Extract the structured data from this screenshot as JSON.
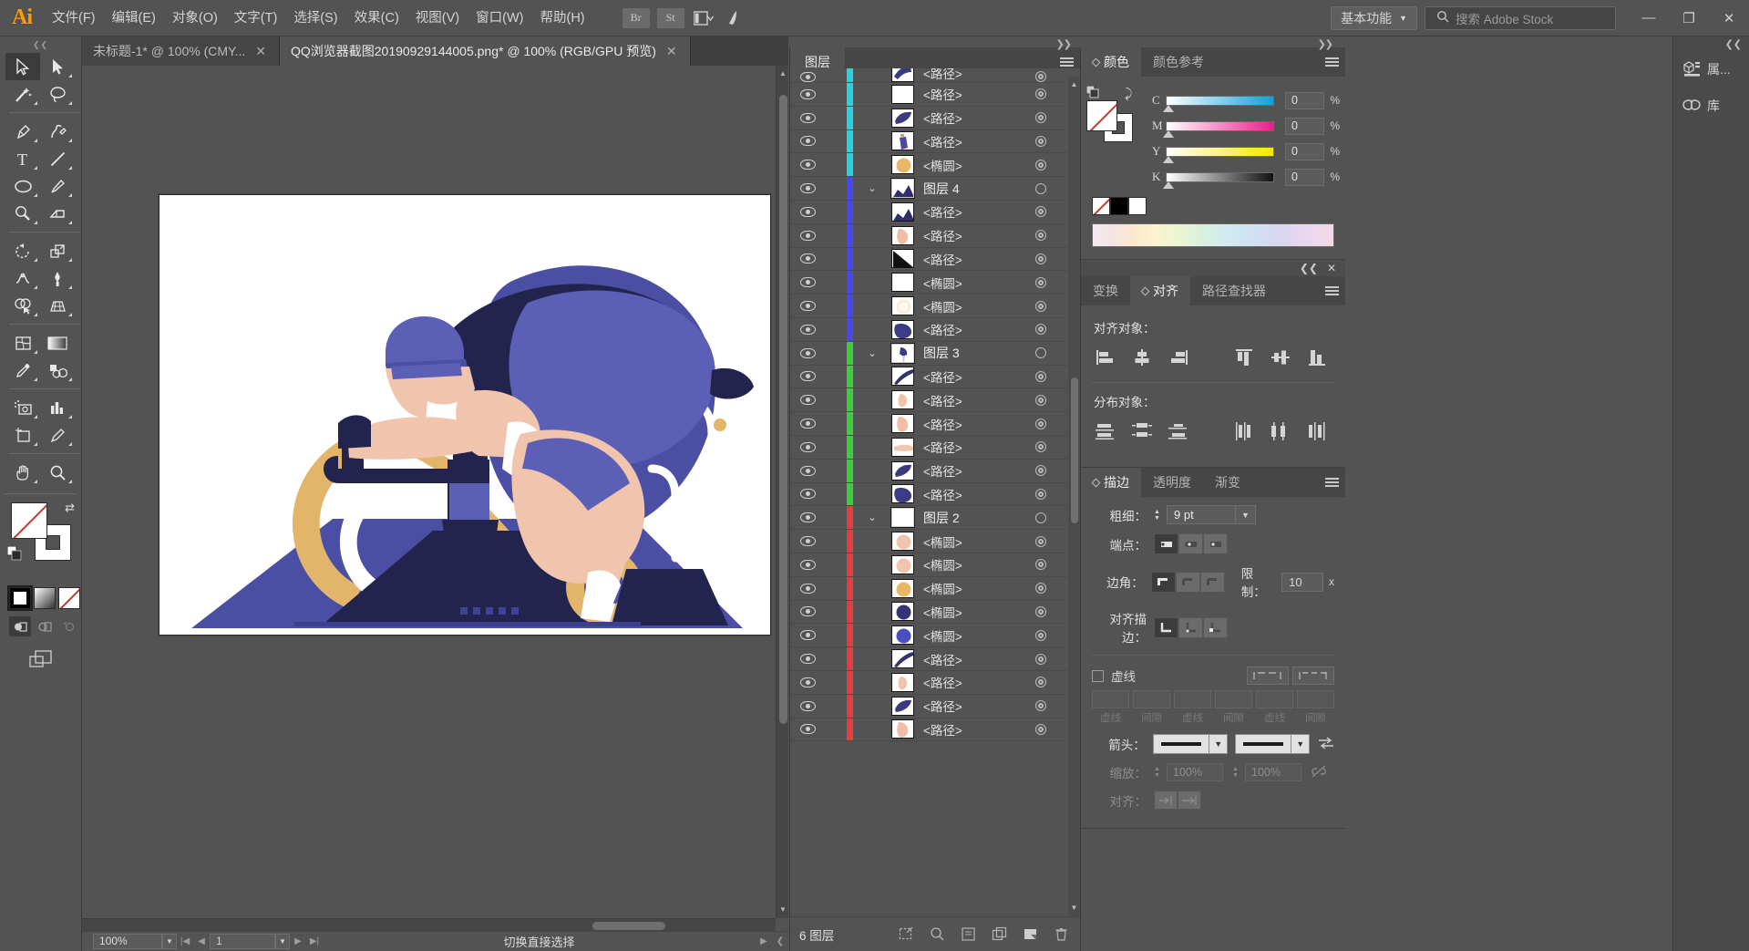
{
  "app": {
    "name": "Adobe Illustrator",
    "logo": "Ai"
  },
  "menubar": {
    "items": [
      {
        "label": "文件(F)",
        "name": "menu-file"
      },
      {
        "label": "编辑(E)",
        "name": "menu-edit"
      },
      {
        "label": "对象(O)",
        "name": "menu-object"
      },
      {
        "label": "文字(T)",
        "name": "menu-type"
      },
      {
        "label": "选择(S)",
        "name": "menu-select"
      },
      {
        "label": "效果(C)",
        "name": "menu-effect"
      },
      {
        "label": "视图(V)",
        "name": "menu-view"
      },
      {
        "label": "窗口(W)",
        "name": "menu-window"
      },
      {
        "label": "帮助(H)",
        "name": "menu-help"
      }
    ],
    "bridge_label": "Br",
    "stock_label": "St",
    "workspace": "基本功能",
    "search_placeholder": "搜索 Adobe Stock",
    "window_minimize": "—",
    "window_restore": "❐",
    "window_close": "✕"
  },
  "tabs": [
    {
      "title": "未标题-1* @ 100% (CMY...",
      "active": false,
      "close": "✕"
    },
    {
      "title": "QQ浏览器截图20190929144005.png* @ 100% (RGB/GPU 预览)",
      "active": true,
      "close": "✕"
    }
  ],
  "toolbar": {
    "tools": [
      {
        "name": "selection-tool",
        "selected": true
      },
      {
        "name": "direct-selection-tool",
        "selected": false
      },
      {
        "name": "magic-wand-tool",
        "selected": false
      },
      {
        "name": "lasso-tool",
        "selected": false
      },
      {
        "name": "pen-tool",
        "selected": false
      },
      {
        "name": "curvature-tool",
        "selected": false
      },
      {
        "name": "type-tool",
        "selected": false
      },
      {
        "name": "line-segment-tool",
        "selected": false
      },
      {
        "name": "ellipse-tool",
        "selected": false
      },
      {
        "name": "paintbrush-tool",
        "selected": false
      },
      {
        "name": "shaper-tool",
        "selected": false
      },
      {
        "name": "eraser-tool",
        "selected": false
      },
      {
        "name": "rotate-tool",
        "selected": false
      },
      {
        "name": "scale-tool",
        "selected": false
      },
      {
        "name": "width-tool",
        "selected": false
      },
      {
        "name": "free-transform-tool",
        "selected": false
      },
      {
        "name": "shape-builder-tool",
        "selected": false
      },
      {
        "name": "perspective-grid-tool",
        "selected": false
      },
      {
        "name": "mesh-tool",
        "selected": false
      },
      {
        "name": "gradient-tool",
        "selected": false
      },
      {
        "name": "eyedropper-tool",
        "selected": false
      },
      {
        "name": "blend-tool",
        "selected": false
      },
      {
        "name": "symbol-sprayer-tool",
        "selected": false
      },
      {
        "name": "column-graph-tool",
        "selected": false
      },
      {
        "name": "artboard-tool",
        "selected": false
      },
      {
        "name": "slice-tool",
        "selected": false
      },
      {
        "name": "hand-tool",
        "selected": false
      },
      {
        "name": "zoom-tool",
        "selected": false
      }
    ],
    "fill_state": "none",
    "stroke_state": "white"
  },
  "document": {
    "artboard_bg": "#ffffff",
    "zoom": "100%",
    "page": "1",
    "status_mode": "切换直接选择"
  },
  "artwork": {
    "title": "cyclist-illustration",
    "colors": {
      "dark_navy": "#23244d",
      "indigo": "#3f3f8f",
      "periwinkle": "#5b5fb5",
      "skin": "#f0c4ad",
      "skin_dark": "#e0aa94",
      "gold": "#e2b56a",
      "white": "#ffffff",
      "base_blue": "#4a4fa3"
    }
  },
  "layers_panel": {
    "tab_label": "图层",
    "footer_count": "6 图层",
    "footer_icons": [
      "make-clipping-mask-icon",
      "locate-object-icon",
      "create-sublayer-icon",
      "create-new-layer-icon",
      "duplicate-layer-icon",
      "delete-selection-icon"
    ],
    "rows": [
      {
        "name": "<路径>",
        "type": "path",
        "group": false,
        "color": "#2ad2e0",
        "thumb": "navy-swoosh",
        "partial": true
      },
      {
        "name": "<路径>",
        "type": "path",
        "group": false,
        "color": "#2ad2e0",
        "thumb": "white"
      },
      {
        "name": "<路径>",
        "type": "path",
        "group": false,
        "color": "#2ad2e0",
        "thumb": "navy-leaf"
      },
      {
        "name": "<路径>",
        "type": "path",
        "group": false,
        "color": "#2ad2e0",
        "thumb": "navy-bottle"
      },
      {
        "name": "<椭圆>",
        "type": "ellipse",
        "group": false,
        "color": "#2ad2e0",
        "thumb": "gold-circle"
      },
      {
        "name": "图层 4",
        "type": "layer",
        "group": true,
        "color": "#4a46e8",
        "thumb": "navy-scene"
      },
      {
        "name": "<路径>",
        "type": "path",
        "group": false,
        "color": "#4a46e8",
        "thumb": "navy-scene"
      },
      {
        "name": "<路径>",
        "type": "path",
        "group": false,
        "color": "#4a46e8",
        "thumb": "skin-shape"
      },
      {
        "name": "<路径>",
        "type": "path",
        "group": false,
        "color": "#4a46e8",
        "thumb": "black-triangle"
      },
      {
        "name": "<椭圆>",
        "type": "ellipse",
        "group": false,
        "color": "#4a46e8",
        "thumb": "white"
      },
      {
        "name": "<椭圆>",
        "type": "ellipse",
        "group": false,
        "color": "#4a46e8",
        "thumb": "cream-circle"
      },
      {
        "name": "<路径>",
        "type": "path",
        "group": false,
        "color": "#4a46e8",
        "thumb": "navy-blob"
      },
      {
        "name": "图层 3",
        "type": "layer",
        "group": true,
        "color": "#3ecc3e",
        "thumb": "navy-small"
      },
      {
        "name": "<路径>",
        "type": "path",
        "group": false,
        "color": "#3ecc3e",
        "thumb": "navy-sliver"
      },
      {
        "name": "<路径>",
        "type": "path",
        "group": false,
        "color": "#3ecc3e",
        "thumb": "skin-hand"
      },
      {
        "name": "<路径>",
        "type": "path",
        "group": false,
        "color": "#3ecc3e",
        "thumb": "skin-shape"
      },
      {
        "name": "<路径>",
        "type": "path",
        "group": false,
        "color": "#3ecc3e",
        "thumb": "skin-arm"
      },
      {
        "name": "<路径>",
        "type": "path",
        "group": false,
        "color": "#3ecc3e",
        "thumb": "navy-leaf"
      },
      {
        "name": "<路径>",
        "type": "path",
        "group": false,
        "color": "#3ecc3e",
        "thumb": "navy-blob"
      },
      {
        "name": "图层 2",
        "type": "layer",
        "group": true,
        "color": "#e04040",
        "thumb": "white"
      },
      {
        "name": "<椭圆>",
        "type": "ellipse",
        "group": false,
        "color": "#e04040",
        "thumb": "skin-circle"
      },
      {
        "name": "<椭圆>",
        "type": "ellipse",
        "group": false,
        "color": "#e04040",
        "thumb": "skin-circle"
      },
      {
        "name": "<椭圆>",
        "type": "ellipse",
        "group": false,
        "color": "#e04040",
        "thumb": "gold-circle"
      },
      {
        "name": "<椭圆>",
        "type": "ellipse",
        "group": false,
        "color": "#e04040",
        "thumb": "navy-circle"
      },
      {
        "name": "<椭圆>",
        "type": "ellipse",
        "group": false,
        "color": "#e04040",
        "thumb": "blue-circle"
      },
      {
        "name": "<路径>",
        "type": "path",
        "group": false,
        "color": "#e04040",
        "thumb": "navy-sliver"
      },
      {
        "name": "<路径>",
        "type": "path",
        "group": false,
        "color": "#e04040",
        "thumb": "skin-hand"
      },
      {
        "name": "<路径>",
        "type": "path",
        "group": false,
        "color": "#e04040",
        "thumb": "navy-leaf"
      },
      {
        "name": "<路径>",
        "type": "path",
        "group": false,
        "color": "#e04040",
        "thumb": "skin-shape"
      }
    ]
  },
  "color_panel": {
    "tabs": [
      {
        "label": "颜色",
        "active": true
      },
      {
        "label": "颜色参考",
        "active": false
      }
    ],
    "model": "CMYK",
    "sliders": [
      {
        "label": "C",
        "value": "0",
        "unit": "%"
      },
      {
        "label": "M",
        "value": "0",
        "unit": "%"
      },
      {
        "label": "Y",
        "value": "0",
        "unit": "%"
      },
      {
        "label": "K",
        "value": "0",
        "unit": "%"
      }
    ]
  },
  "align_panel": {
    "tabs": [
      {
        "label": "变换",
        "active": false
      },
      {
        "label": "对齐",
        "active": true
      },
      {
        "label": "路径查找器",
        "active": false
      }
    ],
    "align_objects_label": "对齐对象：",
    "distribute_objects_label": "分布对象：",
    "align_buttons": [
      "align-left-icon",
      "align-horizontal-center-icon",
      "align-right-icon",
      "align-top-icon",
      "align-vertical-center-icon",
      "align-bottom-icon"
    ],
    "distribute_buttons": [
      "distribute-top-icon",
      "distribute-vertical-center-icon",
      "distribute-bottom-icon",
      "distribute-left-icon",
      "distribute-horizontal-center-icon",
      "distribute-right-icon"
    ],
    "collapse_label": "❮❮",
    "close_label": "✕"
  },
  "stroke_panel": {
    "tabs": [
      {
        "label": "描边",
        "active": true
      },
      {
        "label": "透明度",
        "active": false
      },
      {
        "label": "渐变",
        "active": false
      }
    ],
    "weight_label": "粗细：",
    "weight_value": "9 pt",
    "cap_label": "端点：",
    "corner_label": "边角：",
    "limit_label": "限制：",
    "limit_value": "10",
    "limit_unit": "x",
    "align_stroke_label": "对齐描边：",
    "dashed_label": "虚线",
    "dash_labels": [
      "虚线",
      "间隙",
      "虚线",
      "间隙",
      "虚线",
      "间隙"
    ],
    "arrow_label": "箭头：",
    "scale_label": "缩放：",
    "scale_values": [
      "100%",
      "100%"
    ],
    "align_label": "对齐："
  },
  "dock": {
    "items": [
      {
        "label": "属...",
        "icon": "properties-icon"
      },
      {
        "label": "库",
        "icon": "libraries-icon"
      }
    ],
    "collapse": "❮❮"
  }
}
